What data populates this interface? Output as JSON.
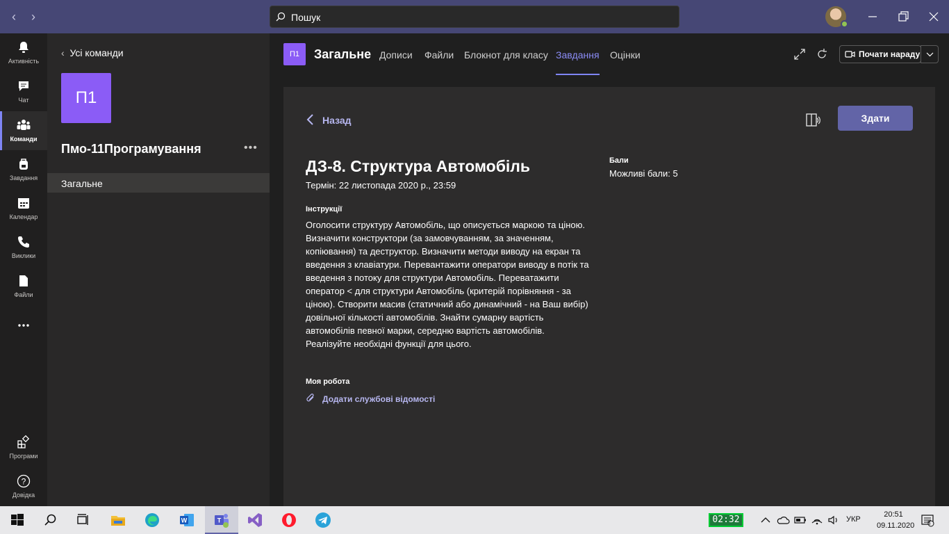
{
  "titlebar": {
    "search_placeholder": "Пошук"
  },
  "rail": {
    "items": [
      {
        "label": "Активність"
      },
      {
        "label": "Чат"
      },
      {
        "label": "Команди"
      },
      {
        "label": "Завдання"
      },
      {
        "label": "Календар"
      },
      {
        "label": "Виклики"
      },
      {
        "label": "Файли"
      }
    ],
    "apps_label": "Програми",
    "help_label": "Довідка"
  },
  "teampane": {
    "back_label": "Усі команди",
    "team_tile": "П1",
    "team_name": "Пмо-11Програмування",
    "channel": "Загальне"
  },
  "header": {
    "channel_icon": "П1",
    "channel_title": "Загальне",
    "tabs": [
      "Дописи",
      "Файли",
      "Блокнот для класу",
      "Завдання",
      "Оцінки"
    ],
    "active_tab": "Завдання",
    "meet_label": "Почати нараду"
  },
  "assignment": {
    "back_label": "Назад",
    "submit_label": "Здати",
    "title": "ДЗ-8. Структура Автомобіль",
    "due": "Термін: 22 листопада 2020 р., 23:59",
    "instructions_heading": "Інструкції",
    "instructions": "Оголосити структуру Автомобіль, що описується маркою та ціною. Визначити конструктори (за замовчуванням, за значенням, копіювання) та деструктор. Визначити методи виводу на екран та введення з клавіатури. Перевантажити оператори виводу в потік та введення з потоку для структури Автомобіль. Переватажити оператор < для структури Автомобіль (критерій порівняння - за ціною). Створити масив (статичний або динамічний - на Ваш вибір) довільної кількості автомобілів. Знайти сумарну вартість автомобілів певної марки, середню вартість автомобілів. Реалізуйте необхідні функції для цього.",
    "my_work_heading": "Моя робота",
    "attach_label": "Додати службові відомості",
    "points_heading": "Бали",
    "points": "Можливі бали: 5"
  },
  "taskbar": {
    "timer": "02:32",
    "lang": "УКР",
    "time": "20:51",
    "date": "09.11.2020",
    "notif_count": "3"
  },
  "colors": {
    "accent": "#6264a7",
    "titlebar": "#464775",
    "team_tile": "#8b5cf6"
  }
}
